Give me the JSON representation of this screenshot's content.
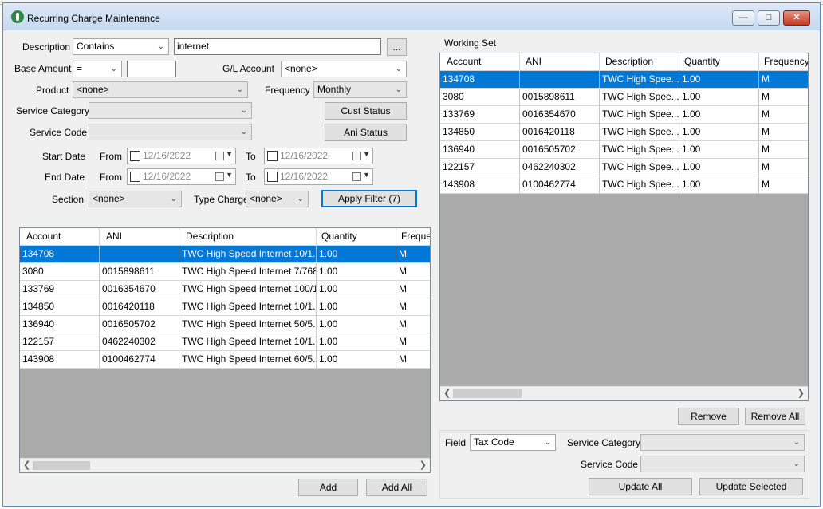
{
  "window": {
    "title": "Recurring Charge Maintenance"
  },
  "filters": {
    "description_label": "Description",
    "description_mode": "Contains",
    "description_value": "internet",
    "ellipsis_label": "...",
    "base_amount_label": "Base Amount",
    "base_amount_op": "=",
    "base_amount_value": "",
    "gl_account_label": "G/L Account",
    "gl_account_value": "<none>",
    "product_label": "Product",
    "product_value": "<none>",
    "frequency_label": "Frequency",
    "frequency_value": "Monthly",
    "service_category_label": "Service Category",
    "service_category_value": "",
    "service_code_label": "Service Code",
    "service_code_value": "",
    "cust_status_label": "Cust Status",
    "ani_status_label": "Ani Status",
    "start_date_label": "Start Date",
    "end_date_label": "End Date",
    "from_label": "From",
    "to_label": "To",
    "date_placeholder": "12/16/2022",
    "section_label": "Section",
    "section_value": "<none>",
    "type_charge_label": "Type Charge",
    "type_charge_value": "<none>",
    "apply_filter_label": "Apply Filter (7)"
  },
  "left_grid": {
    "columns": [
      "Account",
      "ANI",
      "Description",
      "Quantity",
      "Freque"
    ],
    "rows": [
      [
        "134708",
        "",
        "TWC High Speed Internet 10/1...",
        "1.00",
        "M"
      ],
      [
        "3080",
        "0015898611",
        "TWC High Speed Internet 7/768...",
        "1.00",
        "M"
      ],
      [
        "133769",
        "0016354670",
        "TWC High Speed Internet 100/1...",
        "1.00",
        "M"
      ],
      [
        "134850",
        "0016420118",
        "TWC High Speed Internet 10/1...",
        "1.00",
        "M"
      ],
      [
        "136940",
        "0016505702",
        "TWC High Speed Internet 50/5...",
        "1.00",
        "M"
      ],
      [
        "122157",
        "0462240302",
        "TWC High Speed Internet 10/1...",
        "1.00",
        "M"
      ],
      [
        "143908",
        "0100462774",
        "TWC High Speed Internet 60/5...",
        "1.00",
        "M"
      ]
    ],
    "add_label": "Add",
    "add_all_label": "Add All"
  },
  "working_set": {
    "title": "Working Set",
    "columns": [
      "Account",
      "ANI",
      "Description",
      "Quantity",
      "Frequency"
    ],
    "rows": [
      [
        "134708",
        "",
        "TWC High Spee...",
        "1.00",
        "M"
      ],
      [
        "3080",
        "0015898611",
        "TWC High Spee...",
        "1.00",
        "M"
      ],
      [
        "133769",
        "0016354670",
        "TWC High Spee...",
        "1.00",
        "M"
      ],
      [
        "134850",
        "0016420118",
        "TWC High Spee...",
        "1.00",
        "M"
      ],
      [
        "136940",
        "0016505702",
        "TWC High Spee...",
        "1.00",
        "M"
      ],
      [
        "122157",
        "0462240302",
        "TWC High Spee...",
        "1.00",
        "M"
      ],
      [
        "143908",
        "0100462774",
        "TWC High Spee...",
        "1.00",
        "M"
      ]
    ],
    "remove_label": "Remove",
    "remove_all_label": "Remove All"
  },
  "update_panel": {
    "field_label": "Field",
    "field_value": "Tax Code",
    "service_category_label": "Service Category",
    "service_category_value": "",
    "service_code_label": "Service Code",
    "service_code_value": "",
    "update_all_label": "Update All",
    "update_selected_label": "Update Selected"
  },
  "colors": {
    "selection": "#0078d7",
    "grid_empty": "#aaaaaa"
  },
  "icons": {
    "app": "green-keyhole-icon",
    "minimize": "minimize-icon",
    "maximize": "maximize-icon",
    "close": "close-icon"
  }
}
